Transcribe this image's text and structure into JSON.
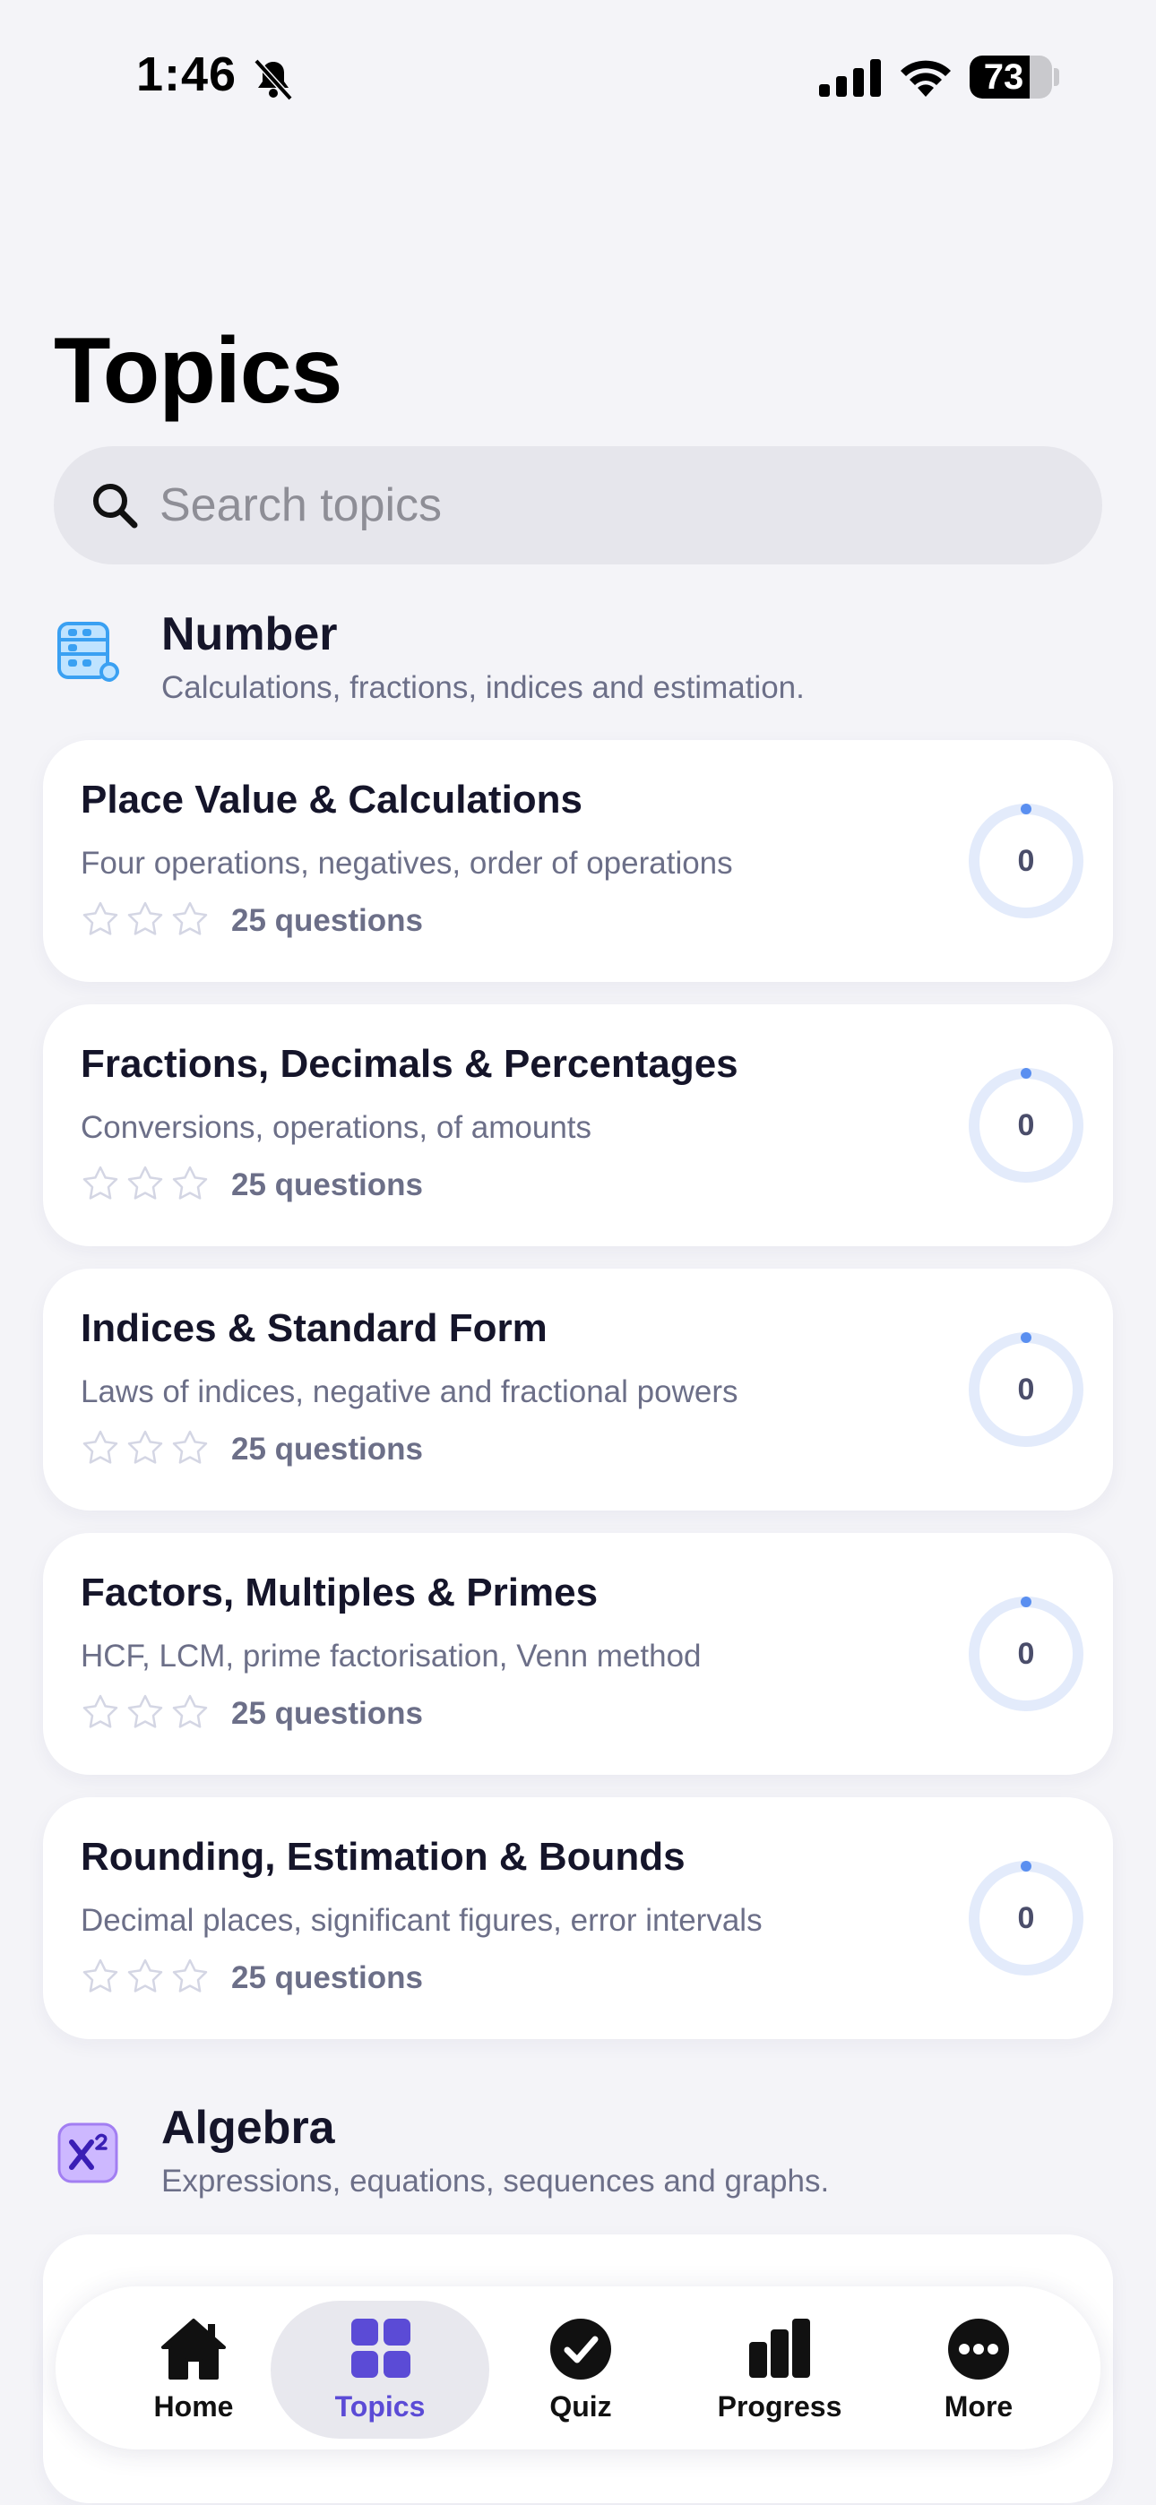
{
  "status_bar": {
    "time": "1:46",
    "battery_level": "73"
  },
  "page": {
    "title": "Topics"
  },
  "search": {
    "placeholder": "Search topics",
    "value": ""
  },
  "sections": [
    {
      "icon": "abacus-icon",
      "title": "Number",
      "subtitle": "Calculations, fractions, indices and estimation.",
      "topics": [
        {
          "title": "Place Value & Calculations",
          "description": "Four operations, negatives, order of operations",
          "stars": 0,
          "questions": "25 questions",
          "progress": "0"
        },
        {
          "title": "Fractions, Decimals & Percentages",
          "description": "Conversions, operations, of amounts",
          "stars": 0,
          "questions": "25 questions",
          "progress": "0"
        },
        {
          "title": "Indices & Standard Form",
          "description": "Laws of indices, negative and fractional powers",
          "stars": 0,
          "questions": "25 questions",
          "progress": "0"
        },
        {
          "title": "Factors, Multiples & Primes",
          "description": "HCF, LCM, prime factorisation, Venn method",
          "stars": 0,
          "questions": "25 questions",
          "progress": "0"
        },
        {
          "title": "Rounding, Estimation & Bounds",
          "description": "Decimal places, significant figures, error intervals",
          "stars": 0,
          "questions": "25 questions",
          "progress": "0"
        }
      ]
    },
    {
      "icon": "x-squared-icon",
      "title": "Algebra",
      "subtitle": "Expressions, equations, sequences and graphs."
    }
  ],
  "tab_bar": {
    "items": [
      {
        "label": "Home",
        "icon": "house-icon",
        "active": false
      },
      {
        "label": "Topics",
        "icon": "grid-icon",
        "active": true
      },
      {
        "label": "Quiz",
        "icon": "checkmark-circle-icon",
        "active": false
      },
      {
        "label": "Progress",
        "icon": "bar-chart-icon",
        "active": false
      },
      {
        "label": "More",
        "icon": "ellipsis-circle-icon",
        "active": false
      }
    ]
  },
  "colors": {
    "accent": "#5b4bd6",
    "ring_track": "#e3ebfb",
    "ring_dot": "#5a8ff0",
    "background": "#f4f4f8"
  }
}
